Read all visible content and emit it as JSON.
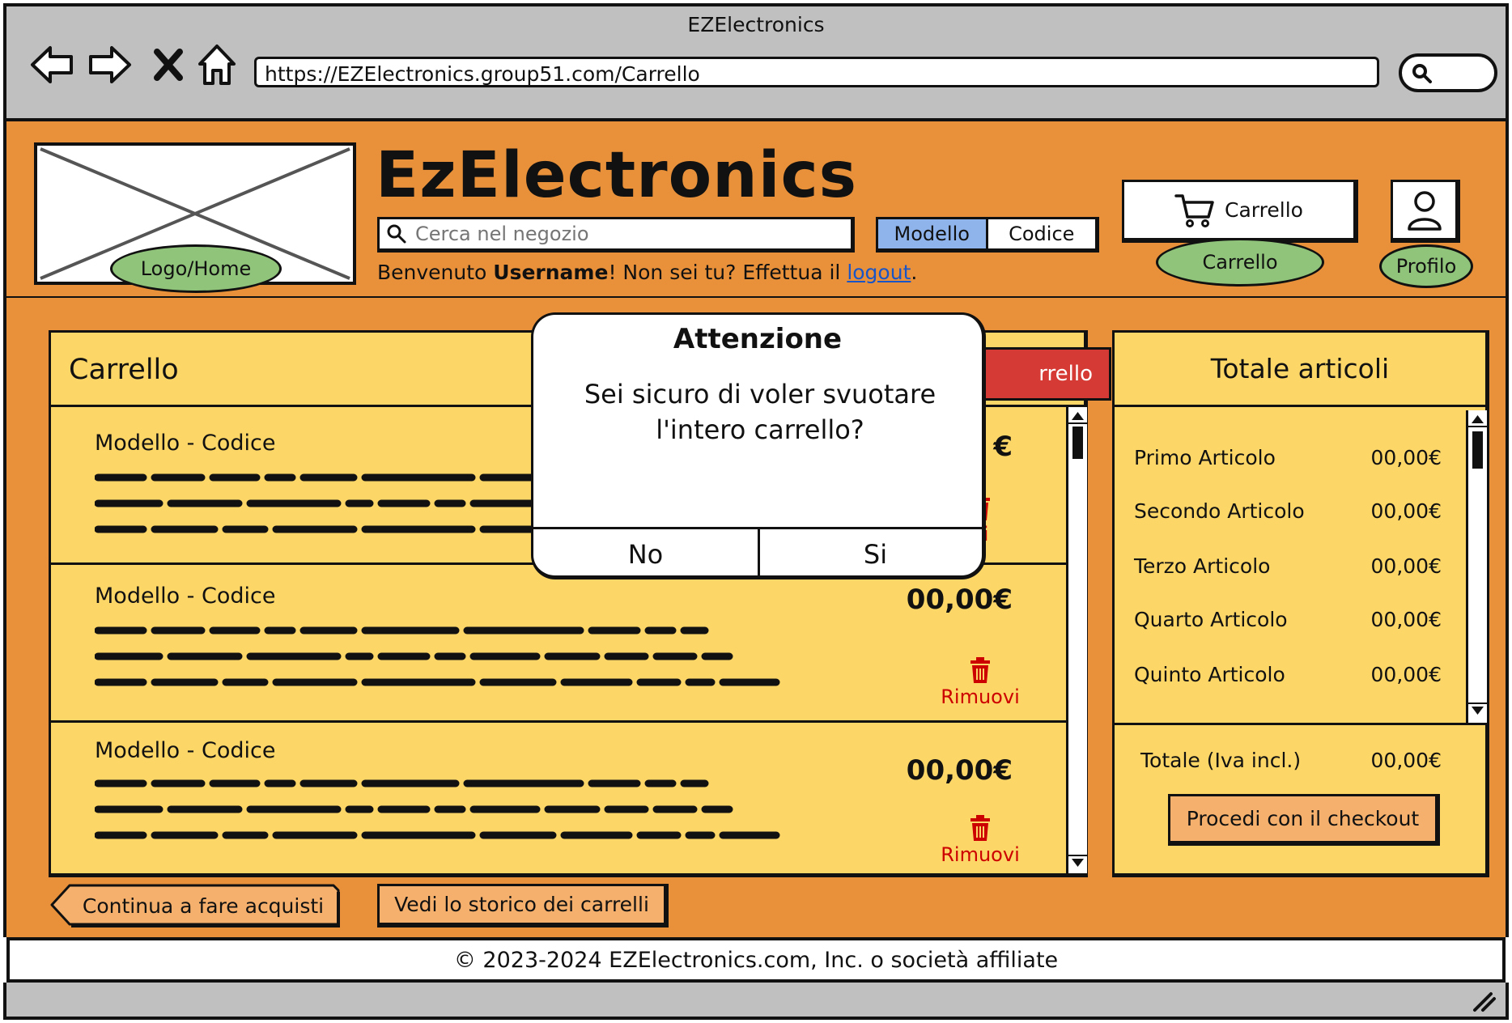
{
  "window": {
    "title": "EZElectronics"
  },
  "browser": {
    "url": "https://EZElectronics.group51.com/Carrello",
    "icons": [
      "back-arrow-icon",
      "forward-arrow-icon",
      "close-icon",
      "home-icon",
      "search-icon"
    ]
  },
  "header": {
    "logo_note": "Logo/Home",
    "site_title": "EzElectronics",
    "search_placeholder": "Cerca nel negozio",
    "search_modes": [
      "Modello",
      "Codice"
    ],
    "search_mode_selected": "Modello",
    "welcome_prefix": "Benvenuto ",
    "username": "Username",
    "welcome_middle": "! Non sei tu? Effettua il ",
    "logout_label": "logout",
    "welcome_suffix": ".",
    "cart_button_label": "Carrello",
    "cart_note": "Carrello",
    "profile_note": "Profilo"
  },
  "cart": {
    "title": "Carrello",
    "empty_button_label_visible": "rrello",
    "items": [
      {
        "title": "Modello - Codice",
        "price": "€",
        "remove_label": "vi"
      },
      {
        "title": "Modello - Codice",
        "price": "00,00€",
        "remove_label": "Rimuovi"
      },
      {
        "title": "Modello - Codice",
        "price": "00,00€",
        "remove_label": "Rimuovi"
      }
    ]
  },
  "totals": {
    "title": "Totale articoli",
    "rows": [
      {
        "label": "Primo Articolo",
        "value": "00,00€"
      },
      {
        "label": "Secondo Articolo",
        "value": "00,00€"
      },
      {
        "label": "Terzo Articolo",
        "value": "00,00€"
      },
      {
        "label": "Quarto Articolo",
        "value": "00,00€"
      },
      {
        "label": "Quinto Articolo",
        "value": "00,00€"
      }
    ],
    "total_label": "Totale (Iva incl.)",
    "total_value": "00,00€",
    "checkout_label": "Procedi con il checkout"
  },
  "actions": {
    "continue_label": "Continua a fare acquisti",
    "history_label": "Vedi lo storico dei carrelli"
  },
  "footer": {
    "text": "© 2023-2024 EZElectronics.com, Inc. o società affiliate"
  },
  "modal": {
    "title": "Attenzione",
    "message": "Sei sicuro di voler svuotare l'intero carrello?",
    "no_label": "No",
    "yes_label": "Si"
  },
  "colors": {
    "page_bg": "#e8913a",
    "panel_bg": "#fcd666",
    "note_green": "#8fc47a",
    "danger_red": "#d63a34",
    "selected_blue": "#8fb4ec",
    "button_orange": "#f4b06c",
    "remove_red": "#cc0000"
  }
}
